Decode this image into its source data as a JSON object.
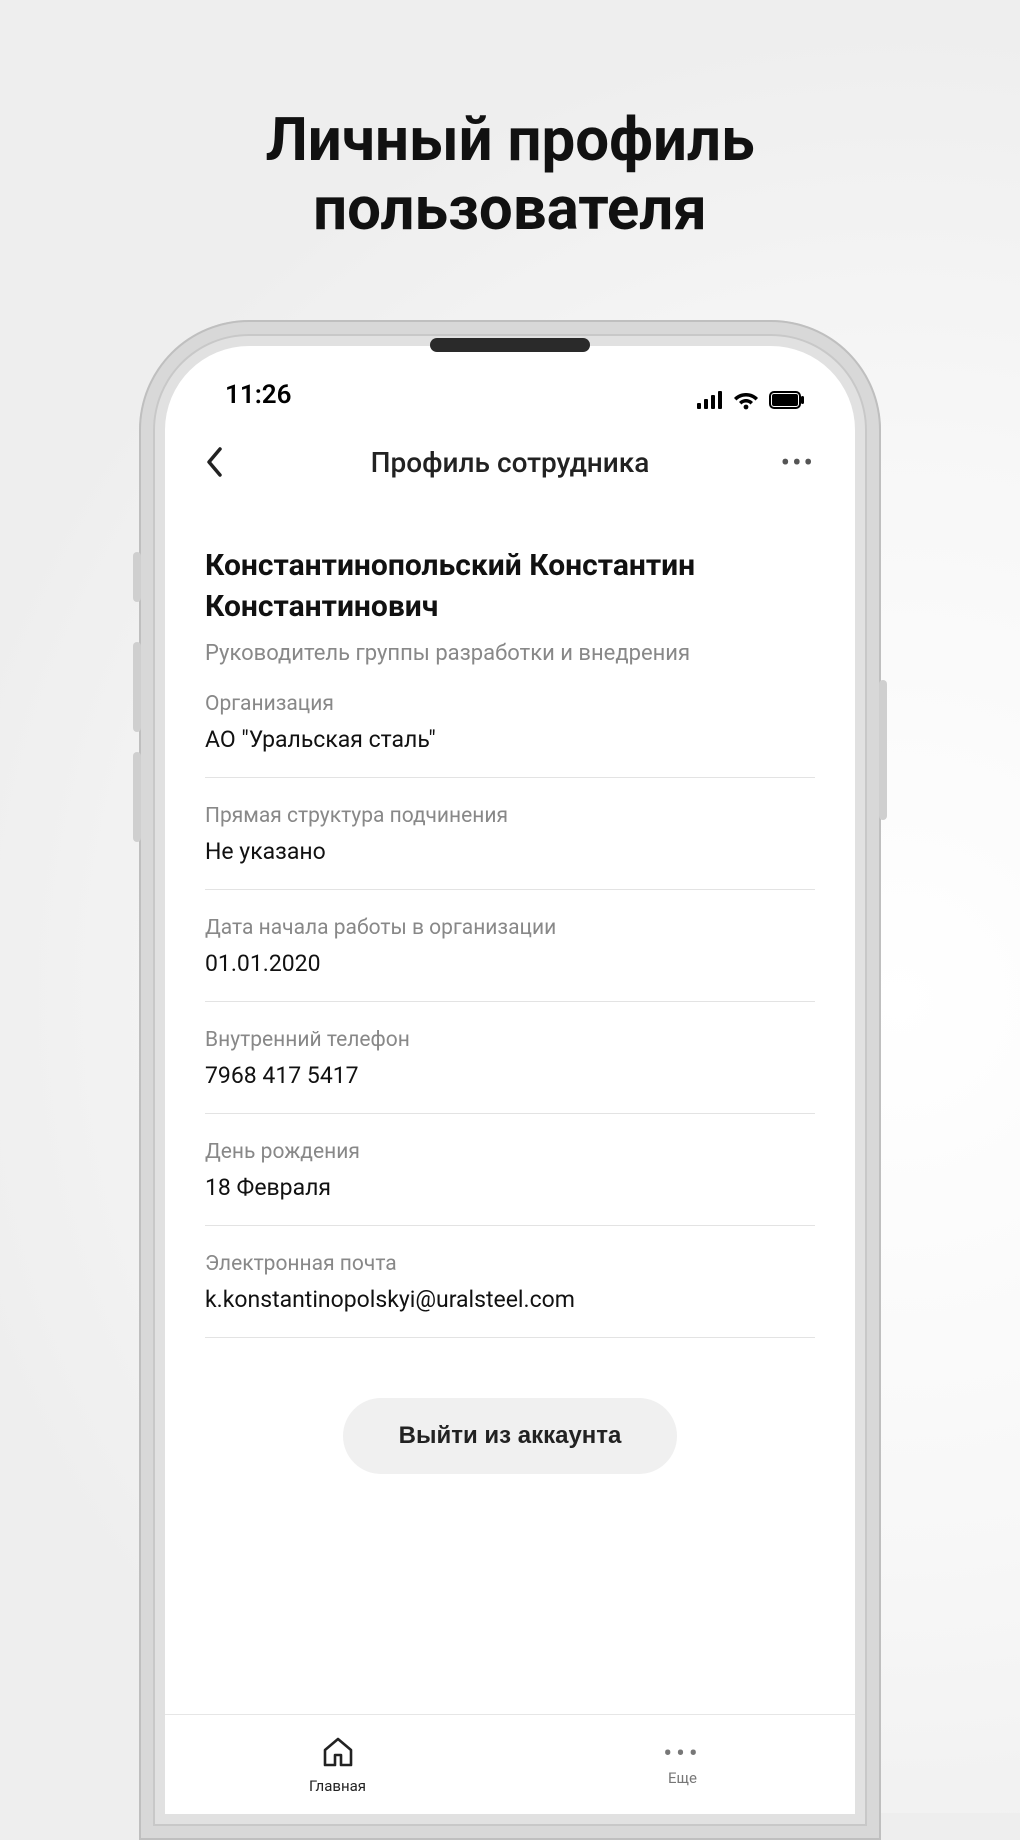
{
  "page_heading_line1": "Личный профиль",
  "page_heading_line2": "пользователя",
  "status": {
    "time": "11:26"
  },
  "nav": {
    "title": "Профиль сотрудника"
  },
  "profile": {
    "name": "Константинопольский Константин Константинович",
    "role": "Руководитель группы разработки и внедрения"
  },
  "fields": {
    "org_label": "Организация",
    "org_value": "АО \"Уральская сталь\"",
    "struct_label": "Прямая структура подчинения",
    "struct_value": "Не указано",
    "start_label": "Дата начала работы в организации",
    "start_value": "01.01.2020",
    "phone_label": "Внутренний телефон",
    "phone_value": "7968 417 5417",
    "bday_label": "День рождения",
    "bday_value": "18 Февраля",
    "email_label": "Электронная почта",
    "email_value": "k.konstantinopolskyi@uralsteel.com"
  },
  "logout_label": "Выйти из аккаунта",
  "tabs": {
    "home": "Главная",
    "more": "Еще"
  }
}
